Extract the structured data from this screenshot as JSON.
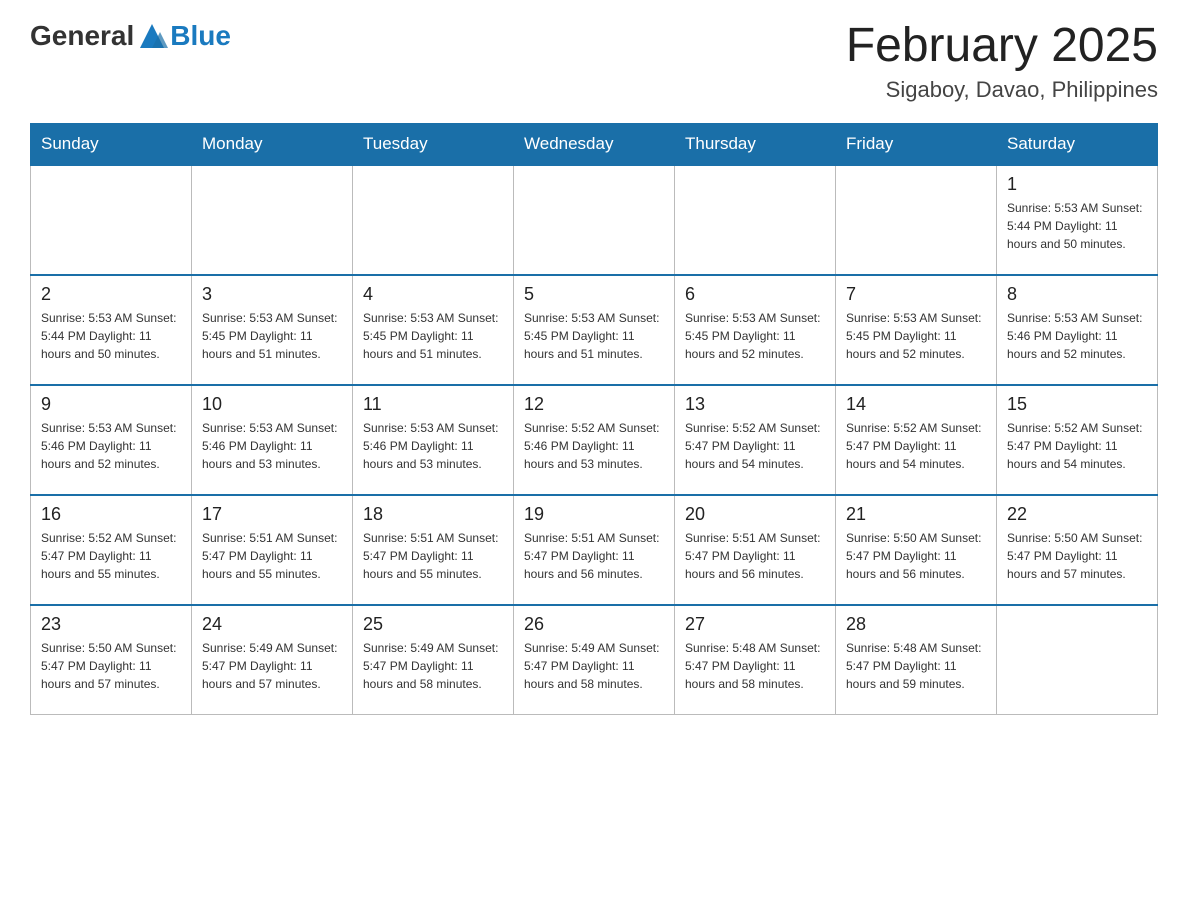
{
  "header": {
    "logo_general": "General",
    "logo_blue": "Blue",
    "month_title": "February 2025",
    "location": "Sigaboy, Davao, Philippines"
  },
  "weekdays": [
    "Sunday",
    "Monday",
    "Tuesday",
    "Wednesday",
    "Thursday",
    "Friday",
    "Saturday"
  ],
  "weeks": [
    [
      {
        "day": "",
        "info": ""
      },
      {
        "day": "",
        "info": ""
      },
      {
        "day": "",
        "info": ""
      },
      {
        "day": "",
        "info": ""
      },
      {
        "day": "",
        "info": ""
      },
      {
        "day": "",
        "info": ""
      },
      {
        "day": "1",
        "info": "Sunrise: 5:53 AM\nSunset: 5:44 PM\nDaylight: 11 hours\nand 50 minutes."
      }
    ],
    [
      {
        "day": "2",
        "info": "Sunrise: 5:53 AM\nSunset: 5:44 PM\nDaylight: 11 hours\nand 50 minutes."
      },
      {
        "day": "3",
        "info": "Sunrise: 5:53 AM\nSunset: 5:45 PM\nDaylight: 11 hours\nand 51 minutes."
      },
      {
        "day": "4",
        "info": "Sunrise: 5:53 AM\nSunset: 5:45 PM\nDaylight: 11 hours\nand 51 minutes."
      },
      {
        "day": "5",
        "info": "Sunrise: 5:53 AM\nSunset: 5:45 PM\nDaylight: 11 hours\nand 51 minutes."
      },
      {
        "day": "6",
        "info": "Sunrise: 5:53 AM\nSunset: 5:45 PM\nDaylight: 11 hours\nand 52 minutes."
      },
      {
        "day": "7",
        "info": "Sunrise: 5:53 AM\nSunset: 5:45 PM\nDaylight: 11 hours\nand 52 minutes."
      },
      {
        "day": "8",
        "info": "Sunrise: 5:53 AM\nSunset: 5:46 PM\nDaylight: 11 hours\nand 52 minutes."
      }
    ],
    [
      {
        "day": "9",
        "info": "Sunrise: 5:53 AM\nSunset: 5:46 PM\nDaylight: 11 hours\nand 52 minutes."
      },
      {
        "day": "10",
        "info": "Sunrise: 5:53 AM\nSunset: 5:46 PM\nDaylight: 11 hours\nand 53 minutes."
      },
      {
        "day": "11",
        "info": "Sunrise: 5:53 AM\nSunset: 5:46 PM\nDaylight: 11 hours\nand 53 minutes."
      },
      {
        "day": "12",
        "info": "Sunrise: 5:52 AM\nSunset: 5:46 PM\nDaylight: 11 hours\nand 53 minutes."
      },
      {
        "day": "13",
        "info": "Sunrise: 5:52 AM\nSunset: 5:47 PM\nDaylight: 11 hours\nand 54 minutes."
      },
      {
        "day": "14",
        "info": "Sunrise: 5:52 AM\nSunset: 5:47 PM\nDaylight: 11 hours\nand 54 minutes."
      },
      {
        "day": "15",
        "info": "Sunrise: 5:52 AM\nSunset: 5:47 PM\nDaylight: 11 hours\nand 54 minutes."
      }
    ],
    [
      {
        "day": "16",
        "info": "Sunrise: 5:52 AM\nSunset: 5:47 PM\nDaylight: 11 hours\nand 55 minutes."
      },
      {
        "day": "17",
        "info": "Sunrise: 5:51 AM\nSunset: 5:47 PM\nDaylight: 11 hours\nand 55 minutes."
      },
      {
        "day": "18",
        "info": "Sunrise: 5:51 AM\nSunset: 5:47 PM\nDaylight: 11 hours\nand 55 minutes."
      },
      {
        "day": "19",
        "info": "Sunrise: 5:51 AM\nSunset: 5:47 PM\nDaylight: 11 hours\nand 56 minutes."
      },
      {
        "day": "20",
        "info": "Sunrise: 5:51 AM\nSunset: 5:47 PM\nDaylight: 11 hours\nand 56 minutes."
      },
      {
        "day": "21",
        "info": "Sunrise: 5:50 AM\nSunset: 5:47 PM\nDaylight: 11 hours\nand 56 minutes."
      },
      {
        "day": "22",
        "info": "Sunrise: 5:50 AM\nSunset: 5:47 PM\nDaylight: 11 hours\nand 57 minutes."
      }
    ],
    [
      {
        "day": "23",
        "info": "Sunrise: 5:50 AM\nSunset: 5:47 PM\nDaylight: 11 hours\nand 57 minutes."
      },
      {
        "day": "24",
        "info": "Sunrise: 5:49 AM\nSunset: 5:47 PM\nDaylight: 11 hours\nand 57 minutes."
      },
      {
        "day": "25",
        "info": "Sunrise: 5:49 AM\nSunset: 5:47 PM\nDaylight: 11 hours\nand 58 minutes."
      },
      {
        "day": "26",
        "info": "Sunrise: 5:49 AM\nSunset: 5:47 PM\nDaylight: 11 hours\nand 58 minutes."
      },
      {
        "day": "27",
        "info": "Sunrise: 5:48 AM\nSunset: 5:47 PM\nDaylight: 11 hours\nand 58 minutes."
      },
      {
        "day": "28",
        "info": "Sunrise: 5:48 AM\nSunset: 5:47 PM\nDaylight: 11 hours\nand 59 minutes."
      },
      {
        "day": "",
        "info": ""
      }
    ]
  ]
}
